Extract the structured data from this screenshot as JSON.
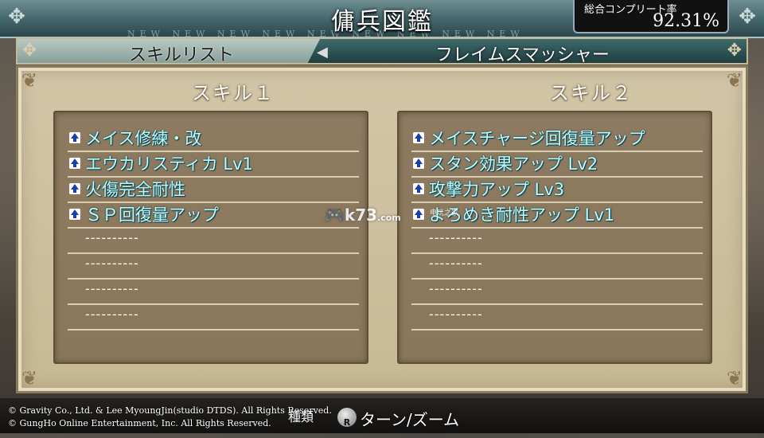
{
  "header": {
    "title": "傭兵図鑑",
    "deco_text": "NEW NEW NEW NEW NEW NEW NEW NEW NEW",
    "completion_label": "総合コンプリート率",
    "completion_value": "92.31%"
  },
  "tabs": {
    "left_label": "スキルリスト",
    "right_label": "フレイムスマッシャー"
  },
  "skill1": {
    "title": "スキル１",
    "items": [
      {
        "label": "メイス修練・改",
        "has_arrow": true
      },
      {
        "label": "エウカリスティカ Lv1",
        "has_arrow": true
      },
      {
        "label": "火傷完全耐性",
        "has_arrow": true
      },
      {
        "label": "ＳＰ回復量アップ",
        "has_arrow": true
      },
      {
        "label": "----------",
        "has_arrow": false
      },
      {
        "label": "----------",
        "has_arrow": false
      },
      {
        "label": "----------",
        "has_arrow": false
      },
      {
        "label": "----------",
        "has_arrow": false
      }
    ]
  },
  "skill2": {
    "title": "スキル２",
    "items": [
      {
        "label": "メイスチャージ回復量アップ",
        "has_arrow": true
      },
      {
        "label": "スタン効果アップ Lv2",
        "has_arrow": true
      },
      {
        "label": "攻撃力アップ Lv3",
        "has_arrow": true
      },
      {
        "label": "よろめき耐性アップ Lv1",
        "has_arrow": true
      },
      {
        "label": "----------",
        "has_arrow": false
      },
      {
        "label": "----------",
        "has_arrow": false
      },
      {
        "label": "----------",
        "has_arrow": false
      },
      {
        "label": "----------",
        "has_arrow": false
      }
    ]
  },
  "watermark": {
    "main": "k73",
    "sub": "电玩之家",
    "domain": ".com"
  },
  "footer": {
    "copyright1": "© Gravity Co., Ltd. & Lee MyoungJin(studio DTDS). All Rights Reserved.",
    "copyright2": "© GungHo Online Entertainment, Inc. All Rights Reserved.",
    "hint_left": "種類",
    "r_button": "R",
    "r_action": "ターン/ズーム"
  },
  "colors": {
    "skill_text": "#b9ffff",
    "upgrade_arrow": "#1f3fa8",
    "panel": "#d2c6a8"
  },
  "icons": [
    "upgrade-arrow-icon",
    "celtic-knot-icon",
    "r-button-icon",
    "corner-ornament-icon"
  ]
}
